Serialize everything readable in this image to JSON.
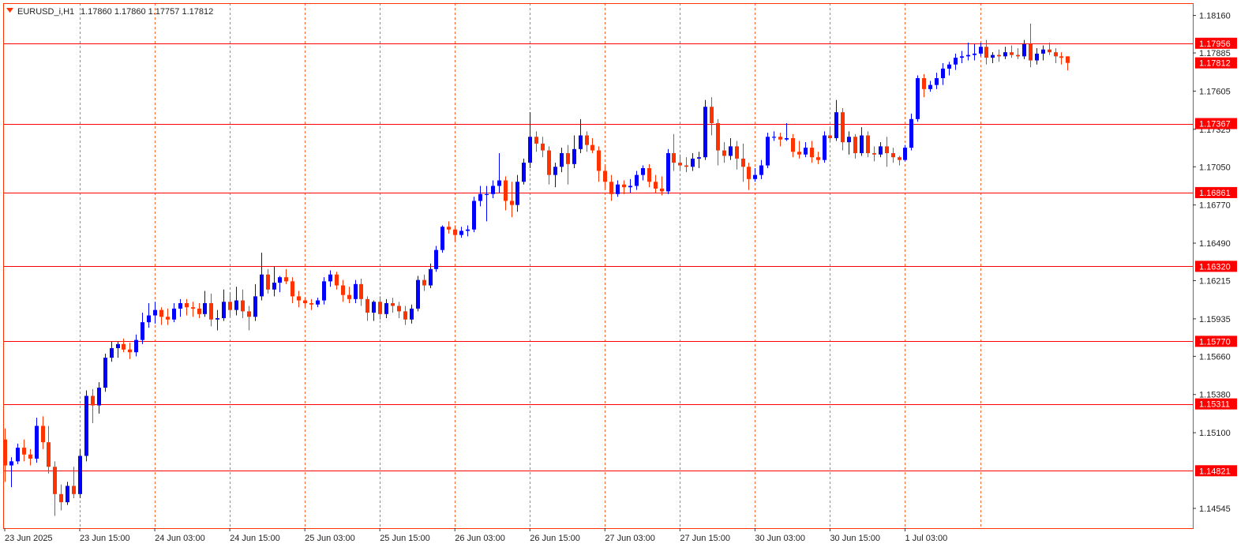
{
  "chart_data": {
    "type": "candlestick",
    "symbol_label": "EURUSD_i,H1",
    "ohlc_label": "1.17860 1.17860 1.17757 1.17812",
    "ylim": [
      1.144,
      1.1825
    ],
    "y_ticks": [
      "1.18160",
      "1.17885",
      "1.17605",
      "1.17325",
      "1.17050",
      "1.16770",
      "1.16490",
      "1.16215",
      "1.15935",
      "1.15660",
      "1.15380",
      "1.15100",
      "1.14545"
    ],
    "x_ticks": [
      {
        "label": "23 Jun 2025",
        "index": 0
      },
      {
        "label": "23 Jun 15:00",
        "index": 12
      },
      {
        "label": "24 Jun 03:00",
        "index": 24
      },
      {
        "label": "24 Jun 15:00",
        "index": 36
      },
      {
        "label": "25 Jun 03:00",
        "index": 48
      },
      {
        "label": "25 Jun 15:00",
        "index": 60
      },
      {
        "label": "26 Jun 03:00",
        "index": 72
      },
      {
        "label": "26 Jun 15:00",
        "index": 84
      },
      {
        "label": "27 Jun 03:00",
        "index": 96
      },
      {
        "label": "27 Jun 15:00",
        "index": 108
      },
      {
        "label": "30 Jun 03:00",
        "index": 120
      },
      {
        "label": "30 Jun 15:00",
        "index": 132
      },
      {
        "label": "1 Jul 03:00",
        "index": 144
      }
    ],
    "vgrid_indices": [
      12,
      24,
      36,
      48,
      60,
      72,
      84,
      96,
      108,
      120,
      132,
      144,
      156
    ],
    "levels": [
      {
        "price": 1.17956,
        "label": "1.17956"
      },
      {
        "price": 1.17367,
        "label": "1.17367"
      },
      {
        "price": 1.16861,
        "label": "1.16861"
      },
      {
        "price": 1.1632,
        "label": "1.16320"
      },
      {
        "price": 1.1577,
        "label": "1.15770"
      },
      {
        "price": 1.15311,
        "label": "1.15311"
      },
      {
        "price": 1.14821,
        "label": "1.14821"
      }
    ],
    "current_price": {
      "price": 1.17812,
      "label": "1.17812"
    },
    "up_color": "#0000ff",
    "down_color": "#ff3300",
    "level_color": "#ff0000",
    "grid_color": "#ff6633",
    "candles": [
      [
        1.1505,
        1.1513,
        1.1474,
        1.1486
      ],
      [
        1.1486,
        1.1492,
        1.147,
        1.1489
      ],
      [
        1.1489,
        1.1502,
        1.1487,
        1.1499
      ],
      [
        1.1499,
        1.1505,
        1.1489,
        1.1494
      ],
      [
        1.1494,
        1.1498,
        1.1486,
        1.1491
      ],
      [
        1.1491,
        1.1521,
        1.1488,
        1.1515
      ],
      [
        1.1515,
        1.1522,
        1.1498,
        1.1503
      ],
      [
        1.1503,
        1.1515,
        1.148,
        1.1485
      ],
      [
        1.1485,
        1.1489,
        1.1449,
        1.1465
      ],
      [
        1.1465,
        1.1472,
        1.1453,
        1.1459
      ],
      [
        1.1459,
        1.1474,
        1.1457,
        1.1471
      ],
      [
        1.1471,
        1.1485,
        1.1462,
        1.1465
      ],
      [
        1.1465,
        1.1498,
        1.1462,
        1.1493
      ],
      [
        1.1493,
        1.1541,
        1.1489,
        1.1537
      ],
      [
        1.1537,
        1.1542,
        1.1517,
        1.153
      ],
      [
        1.153,
        1.1547,
        1.1524,
        1.1543
      ],
      [
        1.1543,
        1.1568,
        1.154,
        1.1565
      ],
      [
        1.1565,
        1.1577,
        1.1562,
        1.1572
      ],
      [
        1.1572,
        1.1577,
        1.1565,
        1.1575
      ],
      [
        1.1575,
        1.1579,
        1.1569,
        1.1571
      ],
      [
        1.1571,
        1.1576,
        1.1564,
        1.1569
      ],
      [
        1.1569,
        1.1582,
        1.1566,
        1.1578
      ],
      [
        1.1578,
        1.1598,
        1.1575,
        1.1591
      ],
      [
        1.1591,
        1.1605,
        1.1587,
        1.1596
      ],
      [
        1.1596,
        1.1606,
        1.159,
        1.16
      ],
      [
        1.16,
        1.1602,
        1.1589,
        1.1595
      ],
      [
        1.1595,
        1.1601,
        1.1589,
        1.1593
      ],
      [
        1.1593,
        1.1605,
        1.1591,
        1.1601
      ],
      [
        1.1601,
        1.1608,
        1.1595,
        1.1605
      ],
      [
        1.1605,
        1.1608,
        1.1596,
        1.1602
      ],
      [
        1.1602,
        1.1606,
        1.1595,
        1.1601
      ],
      [
        1.1601,
        1.1605,
        1.1594,
        1.1597
      ],
      [
        1.1597,
        1.1614,
        1.1595,
        1.1605
      ],
      [
        1.1605,
        1.1612,
        1.1588,
        1.1593
      ],
      [
        1.1593,
        1.16,
        1.1585,
        1.1594
      ],
      [
        1.1594,
        1.1615,
        1.1592,
        1.1606
      ],
      [
        1.1606,
        1.1613,
        1.1595,
        1.16
      ],
      [
        1.16,
        1.1617,
        1.1596,
        1.1607
      ],
      [
        1.1607,
        1.1615,
        1.1594,
        1.1599
      ],
      [
        1.1599,
        1.1603,
        1.1585,
        1.1595
      ],
      [
        1.1595,
        1.1619,
        1.1592,
        1.161
      ],
      [
        1.161,
        1.1642,
        1.1607,
        1.1626
      ],
      [
        1.1626,
        1.163,
        1.1612,
        1.1615
      ],
      [
        1.1615,
        1.1632,
        1.161,
        1.162
      ],
      [
        1.162,
        1.1625,
        1.1613,
        1.1624
      ],
      [
        1.1624,
        1.163,
        1.1619,
        1.1621
      ],
      [
        1.1621,
        1.1624,
        1.1605,
        1.161
      ],
      [
        1.161,
        1.1614,
        1.1602,
        1.1607
      ],
      [
        1.1607,
        1.1609,
        1.1602,
        1.1605
      ],
      [
        1.1605,
        1.1608,
        1.16,
        1.1604
      ],
      [
        1.1604,
        1.1609,
        1.1602,
        1.1607
      ],
      [
        1.1607,
        1.1624,
        1.1604,
        1.1621
      ],
      [
        1.1621,
        1.1629,
        1.1617,
        1.1626
      ],
      [
        1.1626,
        1.1628,
        1.1615,
        1.1618
      ],
      [
        1.1618,
        1.1622,
        1.1606,
        1.1611
      ],
      [
        1.1611,
        1.1617,
        1.1605,
        1.1608
      ],
      [
        1.1608,
        1.1622,
        1.1605,
        1.1619
      ],
      [
        1.1619,
        1.1623,
        1.1603,
        1.1608
      ],
      [
        1.1608,
        1.161,
        1.1592,
        1.1598
      ],
      [
        1.1598,
        1.1607,
        1.1592,
        1.1606
      ],
      [
        1.1606,
        1.161,
        1.1593,
        1.1597
      ],
      [
        1.1597,
        1.1608,
        1.1594,
        1.1605
      ],
      [
        1.1605,
        1.1609,
        1.1598,
        1.1603
      ],
      [
        1.1603,
        1.1606,
        1.1594,
        1.1599
      ],
      [
        1.1599,
        1.1603,
        1.1589,
        1.1593
      ],
      [
        1.1593,
        1.1604,
        1.159,
        1.1601
      ],
      [
        1.1601,
        1.1625,
        1.1599,
        1.1622
      ],
      [
        1.1622,
        1.1626,
        1.1614,
        1.1618
      ],
      [
        1.1618,
        1.1634,
        1.1616,
        1.163
      ],
      [
        1.163,
        1.1647,
        1.1628,
        1.1644
      ],
      [
        1.1644,
        1.1662,
        1.1642,
        1.1661
      ],
      [
        1.1661,
        1.1665,
        1.1656,
        1.1659
      ],
      [
        1.1659,
        1.1662,
        1.165,
        1.1655
      ],
      [
        1.1655,
        1.1661,
        1.1653,
        1.1658
      ],
      [
        1.1658,
        1.1662,
        1.1654,
        1.1659
      ],
      [
        1.1659,
        1.1683,
        1.1657,
        1.168
      ],
      [
        1.168,
        1.1691,
        1.1676,
        1.1685
      ],
      [
        1.1685,
        1.1691,
        1.1665,
        1.1685
      ],
      [
        1.1685,
        1.1695,
        1.1682,
        1.1691
      ],
      [
        1.1691,
        1.1715,
        1.1686,
        1.1695
      ],
      [
        1.1695,
        1.1698,
        1.1673,
        1.168
      ],
      [
        1.168,
        1.1694,
        1.1668,
        1.1677
      ],
      [
        1.1677,
        1.1699,
        1.1672,
        1.1694
      ],
      [
        1.1694,
        1.1711,
        1.1692,
        1.1708
      ],
      [
        1.1708,
        1.1745,
        1.1704,
        1.1727
      ],
      [
        1.1727,
        1.1731,
        1.1716,
        1.1722
      ],
      [
        1.1722,
        1.1727,
        1.1712,
        1.1717
      ],
      [
        1.1717,
        1.172,
        1.1692,
        1.1699
      ],
      [
        1.1699,
        1.1708,
        1.169,
        1.1705
      ],
      [
        1.1705,
        1.1719,
        1.1701,
        1.1715
      ],
      [
        1.1715,
        1.1721,
        1.1692,
        1.1707
      ],
      [
        1.1707,
        1.1728,
        1.1704,
        1.1718
      ],
      [
        1.1718,
        1.174,
        1.1715,
        1.1728
      ],
      [
        1.1728,
        1.1731,
        1.1716,
        1.1721
      ],
      [
        1.1721,
        1.1726,
        1.1715,
        1.1717
      ],
      [
        1.1717,
        1.172,
        1.1694,
        1.1702
      ],
      [
        1.1702,
        1.1706,
        1.1689,
        1.1694
      ],
      [
        1.1694,
        1.1699,
        1.168,
        1.1685
      ],
      [
        1.1685,
        1.1695,
        1.1683,
        1.1692
      ],
      [
        1.1692,
        1.1695,
        1.1685,
        1.169
      ],
      [
        1.169,
        1.1696,
        1.1686,
        1.1691
      ],
      [
        1.1691,
        1.1702,
        1.1688,
        1.1699
      ],
      [
        1.1699,
        1.1706,
        1.1695,
        1.1704
      ],
      [
        1.1704,
        1.1707,
        1.169,
        1.1694
      ],
      [
        1.1694,
        1.1699,
        1.1686,
        1.1689
      ],
      [
        1.1689,
        1.1698,
        1.1684,
        1.1687
      ],
      [
        1.1687,
        1.1718,
        1.1685,
        1.1715
      ],
      [
        1.1715,
        1.1729,
        1.1702,
        1.1708
      ],
      [
        1.1708,
        1.1714,
        1.1702,
        1.1706
      ],
      [
        1.1706,
        1.1712,
        1.1701,
        1.1705
      ],
      [
        1.1705,
        1.1715,
        1.1702,
        1.1711
      ],
      [
        1.1711,
        1.1716,
        1.1704,
        1.1712
      ],
      [
        1.1712,
        1.1754,
        1.171,
        1.1749
      ],
      [
        1.1749,
        1.1756,
        1.1728,
        1.1737
      ],
      [
        1.1737,
        1.174,
        1.1706,
        1.1717
      ],
      [
        1.1717,
        1.1723,
        1.1708,
        1.1713
      ],
      [
        1.1713,
        1.1726,
        1.171,
        1.172
      ],
      [
        1.172,
        1.1724,
        1.1703,
        1.1711
      ],
      [
        1.1711,
        1.1722,
        1.1694,
        1.1705
      ],
      [
        1.1705,
        1.1708,
        1.1688,
        1.1696
      ],
      [
        1.1696,
        1.1704,
        1.1694,
        1.1699
      ],
      [
        1.1699,
        1.171,
        1.1696,
        1.1706
      ],
      [
        1.1706,
        1.173,
        1.1704,
        1.1727
      ],
      [
        1.1727,
        1.1731,
        1.1724,
        1.1727
      ],
      [
        1.1727,
        1.173,
        1.172,
        1.1725
      ],
      [
        1.1725,
        1.1737,
        1.1724,
        1.1726
      ],
      [
        1.1726,
        1.1729,
        1.1712,
        1.1716
      ],
      [
        1.1716,
        1.1724,
        1.1711,
        1.1714
      ],
      [
        1.1714,
        1.1723,
        1.1712,
        1.1719
      ],
      [
        1.1719,
        1.1724,
        1.1708,
        1.1712
      ],
      [
        1.1712,
        1.1716,
        1.1707,
        1.171
      ],
      [
        1.171,
        1.1731,
        1.1708,
        1.1728
      ],
      [
        1.1728,
        1.1734,
        1.1723,
        1.1726
      ],
      [
        1.1726,
        1.1754,
        1.1724,
        1.1745
      ],
      [
        1.1745,
        1.1748,
        1.1717,
        1.1723
      ],
      [
        1.1723,
        1.1731,
        1.1714,
        1.1727
      ],
      [
        1.1727,
        1.1729,
        1.1711,
        1.1715
      ],
      [
        1.1715,
        1.1734,
        1.1713,
        1.1728
      ],
      [
        1.1728,
        1.1731,
        1.1712,
        1.1715
      ],
      [
        1.1715,
        1.172,
        1.1709,
        1.1714
      ],
      [
        1.1714,
        1.1723,
        1.1712,
        1.172
      ],
      [
        1.172,
        1.1727,
        1.1705,
        1.1715
      ],
      [
        1.1715,
        1.1719,
        1.1708,
        1.1712
      ],
      [
        1.1712,
        1.1713,
        1.1706,
        1.171
      ],
      [
        1.171,
        1.1721,
        1.1709,
        1.1719
      ],
      [
        1.1719,
        1.1744,
        1.1717,
        1.174
      ],
      [
        1.174,
        1.1772,
        1.1738,
        1.177
      ],
      [
        1.177,
        1.1773,
        1.1756,
        1.1762
      ],
      [
        1.1762,
        1.1768,
        1.176,
        1.1765
      ],
      [
        1.1765,
        1.1774,
        1.1762,
        1.177
      ],
      [
        1.177,
        1.1781,
        1.1765,
        1.1777
      ],
      [
        1.1777,
        1.1782,
        1.1772,
        1.178
      ],
      [
        1.178,
        1.1788,
        1.1776,
        1.1785
      ],
      [
        1.1785,
        1.179,
        1.1781,
        1.1786
      ],
      [
        1.1786,
        1.1796,
        1.1783,
        1.1787
      ],
      [
        1.1787,
        1.1795,
        1.1783,
        1.1788
      ],
      [
        1.1788,
        1.1796,
        1.1786,
        1.1793
      ],
      [
        1.1793,
        1.1798,
        1.178,
        1.1785
      ],
      [
        1.1785,
        1.1789,
        1.1781,
        1.1787
      ],
      [
        1.1787,
        1.1791,
        1.1782,
        1.1786
      ],
      [
        1.1786,
        1.1793,
        1.1784,
        1.1789
      ],
      [
        1.1789,
        1.1794,
        1.1785,
        1.1787
      ],
      [
        1.1787,
        1.1792,
        1.1784,
        1.1786
      ],
      [
        1.1786,
        1.1798,
        1.1784,
        1.1795
      ],
      [
        1.1795,
        1.181,
        1.1778,
        1.1783
      ],
      [
        1.1783,
        1.1792,
        1.178,
        1.1788
      ],
      [
        1.1788,
        1.1794,
        1.1783,
        1.1791
      ],
      [
        1.1791,
        1.1796,
        1.1787,
        1.1789
      ],
      [
        1.1789,
        1.1792,
        1.1781,
        1.1786
      ],
      [
        1.1786,
        1.1789,
        1.178,
        1.1785
      ],
      [
        1.1786,
        1.1786,
        1.17757,
        1.17812
      ]
    ]
  }
}
